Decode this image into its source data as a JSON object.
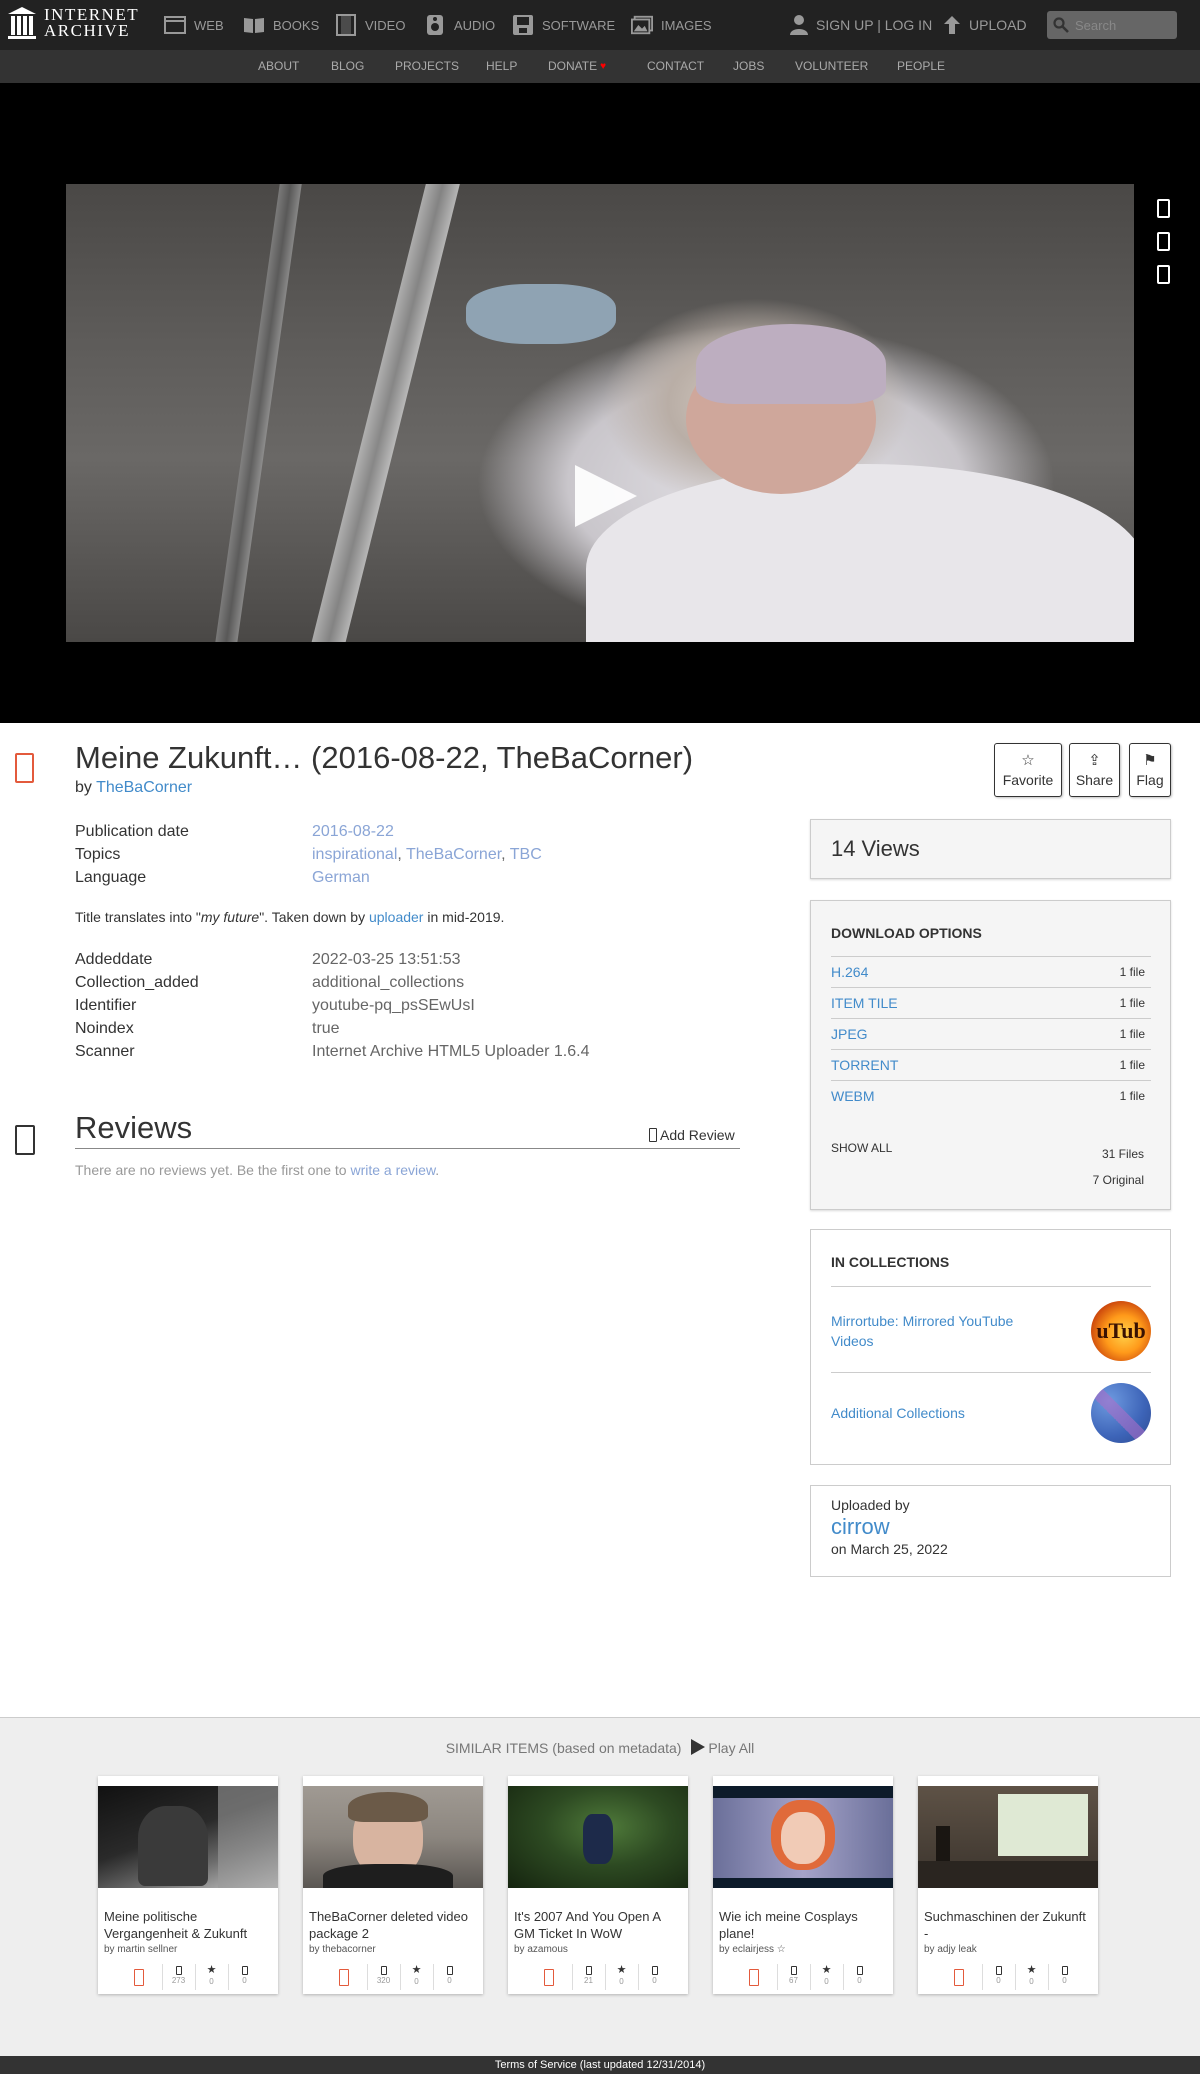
{
  "logo": {
    "line1": "INTERNET",
    "line2": "ARCHIVE"
  },
  "nav": {
    "mediatypes": [
      {
        "label": "WEB",
        "icon": "web-icon"
      },
      {
        "label": "BOOKS",
        "icon": "books-icon"
      },
      {
        "label": "VIDEO",
        "icon": "video-icon"
      },
      {
        "label": "AUDIO",
        "icon": "audio-icon"
      },
      {
        "label": "SOFTWARE",
        "icon": "software-icon"
      },
      {
        "label": "IMAGES",
        "icon": "images-icon"
      }
    ],
    "signin": "SIGN UP | LOG IN",
    "upload": "UPLOAD",
    "search_placeholder": "Search"
  },
  "subnav": [
    "ABOUT",
    "BLOG",
    "PROJECTS",
    "HELP",
    "DONATE",
    "CONTACT",
    "JOBS",
    "VOLUNTEER",
    "PEOPLE"
  ],
  "item": {
    "title": "Meine Zukunft… (2016-08-22, TheBaCorner)",
    "by_label": "by",
    "creator": "TheBaCorner",
    "actions": [
      {
        "label": "Favorite",
        "icon": "☆"
      },
      {
        "label": "Share",
        "icon": "⇪"
      },
      {
        "label": "Flag",
        "icon": "⚑"
      }
    ],
    "metadata": [
      {
        "key": "Publication date",
        "value": "2016-08-22"
      },
      {
        "key": "Topics",
        "values": [
          "inspirational",
          "TheBaCorner",
          "TBC"
        ],
        "sep": ", "
      },
      {
        "key": "Language",
        "value": "German"
      }
    ],
    "description": {
      "pre": "Title translates into \"",
      "em": "my future",
      "mid": "\". Taken down by ",
      "link": "uploader",
      "post": " in mid-2019."
    },
    "metadata2": [
      {
        "key": "Addeddate",
        "value": "2022-03-25 13:51:53"
      },
      {
        "key": "Collection_added",
        "value": "additional_collections"
      },
      {
        "key": "Identifier",
        "value": "youtube-pq_psSEwUsI"
      },
      {
        "key": "Noindex",
        "value": "true"
      },
      {
        "key": "Scanner",
        "value": "Internet Archive HTML5 Uploader 1.6.4"
      }
    ]
  },
  "reviews": {
    "heading": "Reviews",
    "add": "Add Review",
    "empty_pre": "There are no reviews yet. Be the first one to ",
    "empty_link": "write a review",
    "empty_post": "."
  },
  "views": {
    "count": "14",
    "label": "Views"
  },
  "downloads": {
    "title": "DOWNLOAD OPTIONS",
    "rows": [
      {
        "format": "H.264",
        "count": "1 file"
      },
      {
        "format": "ITEM TILE",
        "count": "1 file"
      },
      {
        "format": "JPEG",
        "count": "1 file"
      },
      {
        "format": "TORRENT",
        "count": "1 file"
      },
      {
        "format": "WEBM",
        "count": "1 file"
      }
    ],
    "show_all": "SHOW ALL",
    "total": "31 Files",
    "original": "7 Original"
  },
  "collections": {
    "title": "IN COLLECTIONS",
    "items": [
      {
        "name": "Mirrortube: Mirrored YouTube Videos",
        "thumb_text": "uTub"
      },
      {
        "name": "Additional Collections",
        "thumb_text": ""
      }
    ]
  },
  "uploader": {
    "label": "Uploaded by",
    "name": "cirrow",
    "date": "on March 25, 2022"
  },
  "similar": {
    "heading": "SIMILAR ITEMS (based on metadata)",
    "play_all": "Play All",
    "items": [
      {
        "title": "Meine politische Vergangenheit & Zukunft",
        "by": "by martin sellner",
        "views": "273",
        "favs": "0",
        "reviews": "0"
      },
      {
        "title": "TheBaCorner deleted video package 2",
        "by": "by thebacorner",
        "views": "320",
        "favs": "0",
        "reviews": "0"
      },
      {
        "title": "It's 2007 And You Open A GM Ticket In WoW",
        "by": "by azamous",
        "views": "21",
        "favs": "0",
        "reviews": "0"
      },
      {
        "title": "Wie ich meine Cosplays plane!",
        "by": "by eclairjess ☆",
        "views": "67",
        "favs": "0",
        "reviews": "0"
      },
      {
        "title": "Suchmaschinen der Zukunft -",
        "by": "by adjy leak",
        "views": "0",
        "favs": "0",
        "reviews": "0"
      }
    ]
  },
  "footer": "Terms of Service (last updated 12/31/2014)"
}
